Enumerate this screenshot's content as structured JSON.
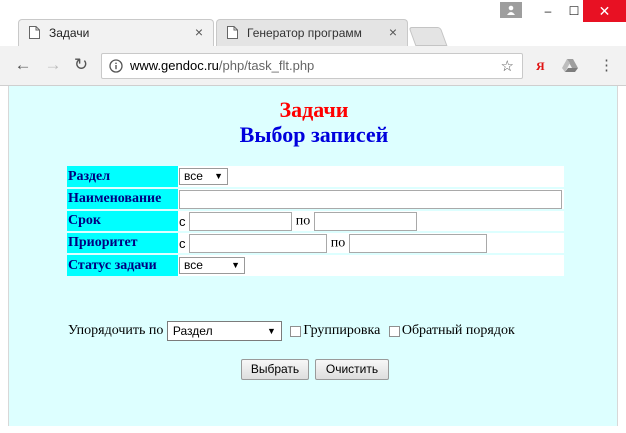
{
  "browser": {
    "tabs": [
      {
        "title": "Задачи",
        "close": "×"
      },
      {
        "title": "Генератор программ",
        "close": "×"
      }
    ],
    "address": {
      "host": "www.gendoc.ru",
      "path": "/php/task_flt.php"
    },
    "extensions": {
      "yandex": "Я"
    },
    "window_buttons": {
      "minimize": "–",
      "maximize": "☐",
      "close": "✕"
    }
  },
  "page": {
    "title": "Задачи",
    "subtitle": "Выбор записей",
    "filters": {
      "section": {
        "label": "Раздел",
        "value": "все"
      },
      "name": {
        "label": "Наименование",
        "value": ""
      },
      "deadline": {
        "label": "Срок",
        "from_label": "с",
        "to_label": "по",
        "from": "",
        "to": ""
      },
      "priority": {
        "label": "Приоритет",
        "from_label": "с",
        "to_label": "по",
        "from": "",
        "to": ""
      },
      "status": {
        "label": "Статус задачи",
        "value": "все"
      }
    },
    "order": {
      "label": "Упорядочить по",
      "value": "Раздел",
      "group_label": "Группировка",
      "reverse_label": "Обратный порядок"
    },
    "buttons": {
      "select": "Выбрать",
      "clear": "Очистить"
    }
  },
  "colors": {
    "page_bg": "#ddffff",
    "label_bg": "#00ffff",
    "label_text": "#000080",
    "title_red": "#ff0000",
    "title_blue": "#0000dd",
    "close_btn": "#e81123"
  }
}
